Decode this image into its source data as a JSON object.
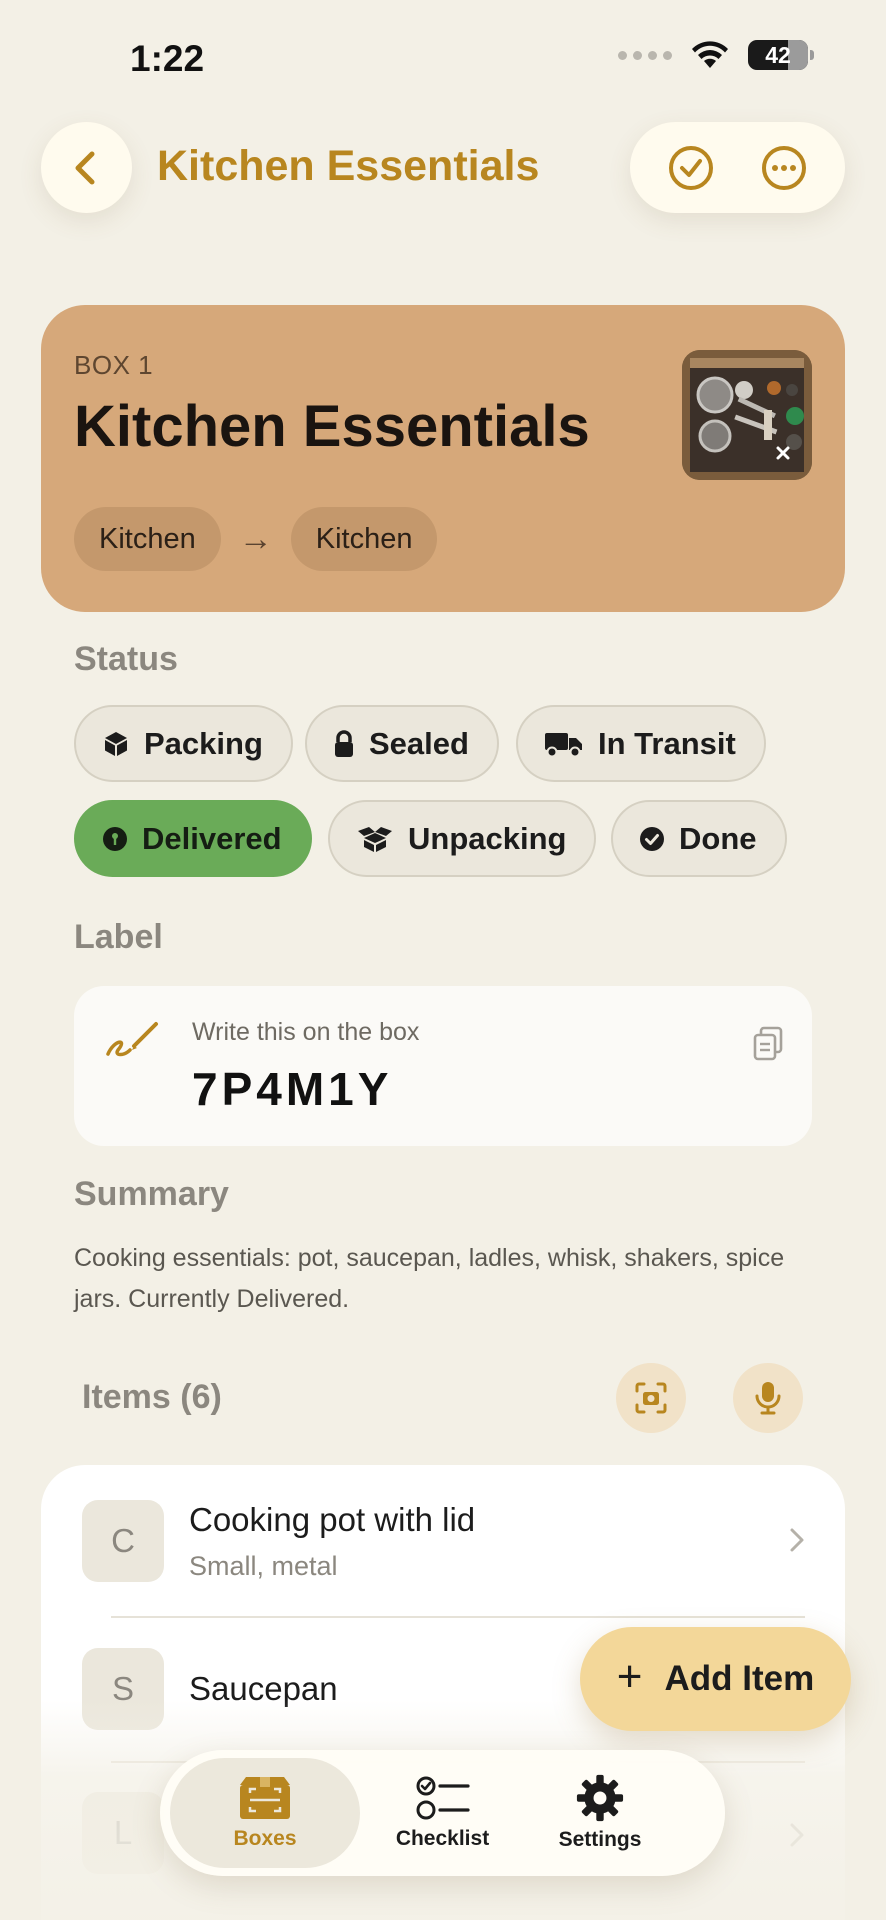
{
  "status_bar": {
    "time": "1:22",
    "battery": "42"
  },
  "header": {
    "title": "Kitchen Essentials"
  },
  "box": {
    "number_label": "BOX 1",
    "title": "Kitchen Essentials",
    "from_room": "Kitchen",
    "to_room": "Kitchen"
  },
  "status": {
    "section_label": "Status",
    "options": [
      {
        "label": "Packing",
        "icon": "box-icon"
      },
      {
        "label": "Sealed",
        "icon": "lock-icon"
      },
      {
        "label": "In Transit",
        "icon": "truck-icon"
      },
      {
        "label": "Delivered",
        "icon": "pin-icon",
        "selected": true
      },
      {
        "label": "Unpacking",
        "icon": "open-box-icon"
      },
      {
        "label": "Done",
        "icon": "check-circle-icon"
      }
    ],
    "selected_color": "#6aab58"
  },
  "label": {
    "section_label": "Label",
    "hint": "Write this on the box",
    "code": "7P4M1Y"
  },
  "summary": {
    "section_label": "Summary",
    "text": "Cooking essentials: pot, saucepan, ladles, whisk, shakers, spice jars. Currently Delivered."
  },
  "items": {
    "section_label": "Items (6)",
    "list": [
      {
        "initial": "C",
        "name": "Cooking pot with lid",
        "detail": "Small, metal"
      },
      {
        "initial": "S",
        "name": "Saucepan",
        "detail": ""
      },
      {
        "initial": "L",
        "name": "",
        "detail": ""
      }
    ]
  },
  "fab": {
    "label": "Add Item"
  },
  "tabbar": {
    "tabs": [
      {
        "label": "Boxes",
        "selected": true
      },
      {
        "label": "Checklist"
      },
      {
        "label": "Settings"
      }
    ]
  },
  "colors": {
    "accent": "#b8861f",
    "background": "#f3f0e6",
    "card": "#d6a87a"
  }
}
